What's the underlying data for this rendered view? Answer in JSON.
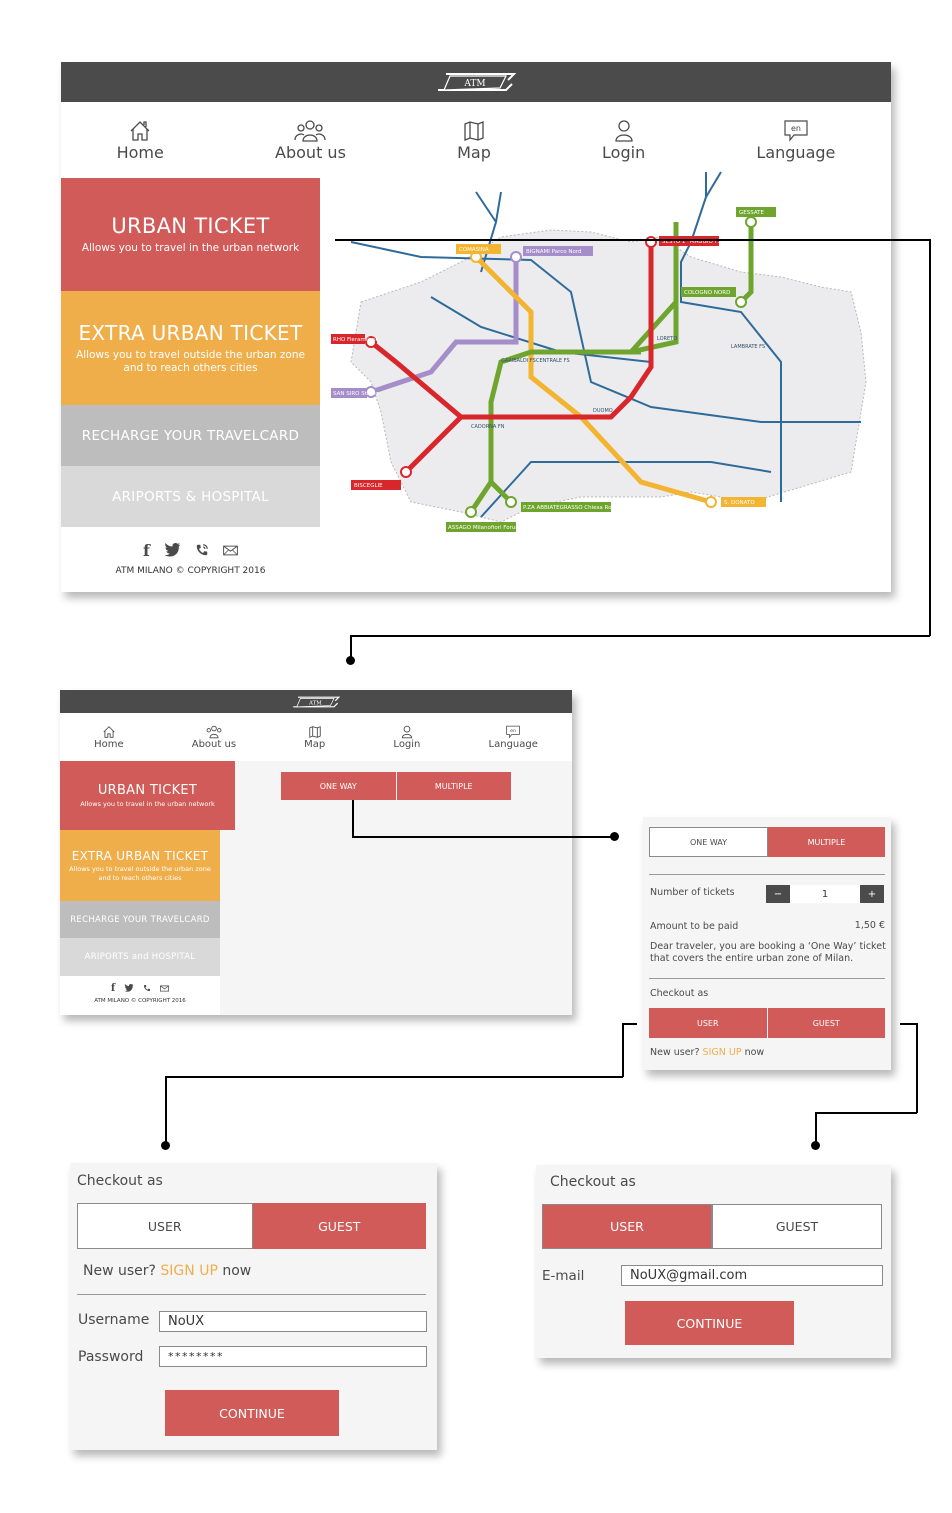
{
  "brand": {
    "logo_text": "ATM",
    "accent": "#d15b58",
    "secondary": "#f0ae4b",
    "dark": "#4b4b4b"
  },
  "nav": {
    "items": [
      {
        "label": "Home",
        "icon": "home-icon"
      },
      {
        "label": "About us",
        "icon": "people-icon"
      },
      {
        "label": "Map",
        "icon": "map-icon"
      },
      {
        "label": "Login",
        "icon": "user-icon"
      },
      {
        "label": "Language",
        "icon": "language-icon",
        "badge": "en"
      }
    ]
  },
  "sidebar": {
    "urban": {
      "title": "URBAN TICKET",
      "subtitle": "Allows you to travel in the urban network"
    },
    "extra": {
      "title": "EXTRA URBAN TICKET",
      "subtitle": "Allows you to travel outside the urban zone and to reach others cities"
    },
    "recharge": {
      "title": "RECHARGE YOUR TRAVELCARD"
    },
    "airports": {
      "title": "ARIPORTS & HOSPITAL",
      "title_alt": "ARIPORTS and HOSPITAL"
    },
    "social": [
      "facebook-icon",
      "twitter-icon",
      "phone-icon",
      "mail-icon"
    ],
    "copyright": "ATM MILANO © COPYRIGHT 2016"
  },
  "map": {
    "stations": {
      "red_north": "SESTO 1° MAGGIO FS",
      "red_west": "RHO Fieramilano",
      "red_southwest": "BISCEGLIE",
      "lilac_north": "BIGNAMI Parco Nord",
      "lilac_west": "SAN SIRO Stadio",
      "yellow_north": "COMASINA",
      "yellow_south": "S. DONATO",
      "green_north": "GESSATE",
      "green_branch": "COLOGNO NORD",
      "green_south1": "ASSAGO Milanofiori Forum",
      "green_south2": "P.ZA ABBIATEGRASSO Chiesa Rossa",
      "central": "CENTRALE FS",
      "duomo": "DUOMO",
      "cadorna": "CADORNA FN",
      "garibaldi": "GARIBALDI FS",
      "loreto": "LORETO",
      "lambrate": "LAMBRATE FS"
    }
  },
  "ticket_screen": {
    "one_way": "ONE WAY",
    "multiple": "MULTIPLE"
  },
  "ticket_detail": {
    "one_way": "ONE WAY",
    "multiple": "MULTIPLE",
    "number_label": "Number of tickets",
    "minus": "−",
    "plus": "+",
    "quantity": "1",
    "amount_label": "Amount to be paid",
    "amount_value": "1,50 €",
    "note": "Dear traveler, you are booking a ‘One Way’ ticket that covers the entire urban zone of Milan.",
    "checkout_label": "Checkout as",
    "user": "USER",
    "guest": "GUEST",
    "new_user_prefix": "New user?",
    "sign_up": "SIGN UP",
    "new_user_suffix": "now"
  },
  "user_checkout": {
    "checkout_label": "Checkout as",
    "user": "USER",
    "guest": "GUEST",
    "new_user_prefix": "New user?",
    "sign_up": "SIGN UP",
    "new_user_suffix": "now",
    "username_label": "Username",
    "username_value": "NoUX",
    "password_label": "Password",
    "password_value": "********",
    "continue": "CONTINUE"
  },
  "guest_checkout": {
    "checkout_label": "Checkout as",
    "user": "USER",
    "guest": "GUEST",
    "email_label": "E-mail",
    "email_value": "NoUX@gmail.com",
    "continue": "CONTINUE"
  }
}
